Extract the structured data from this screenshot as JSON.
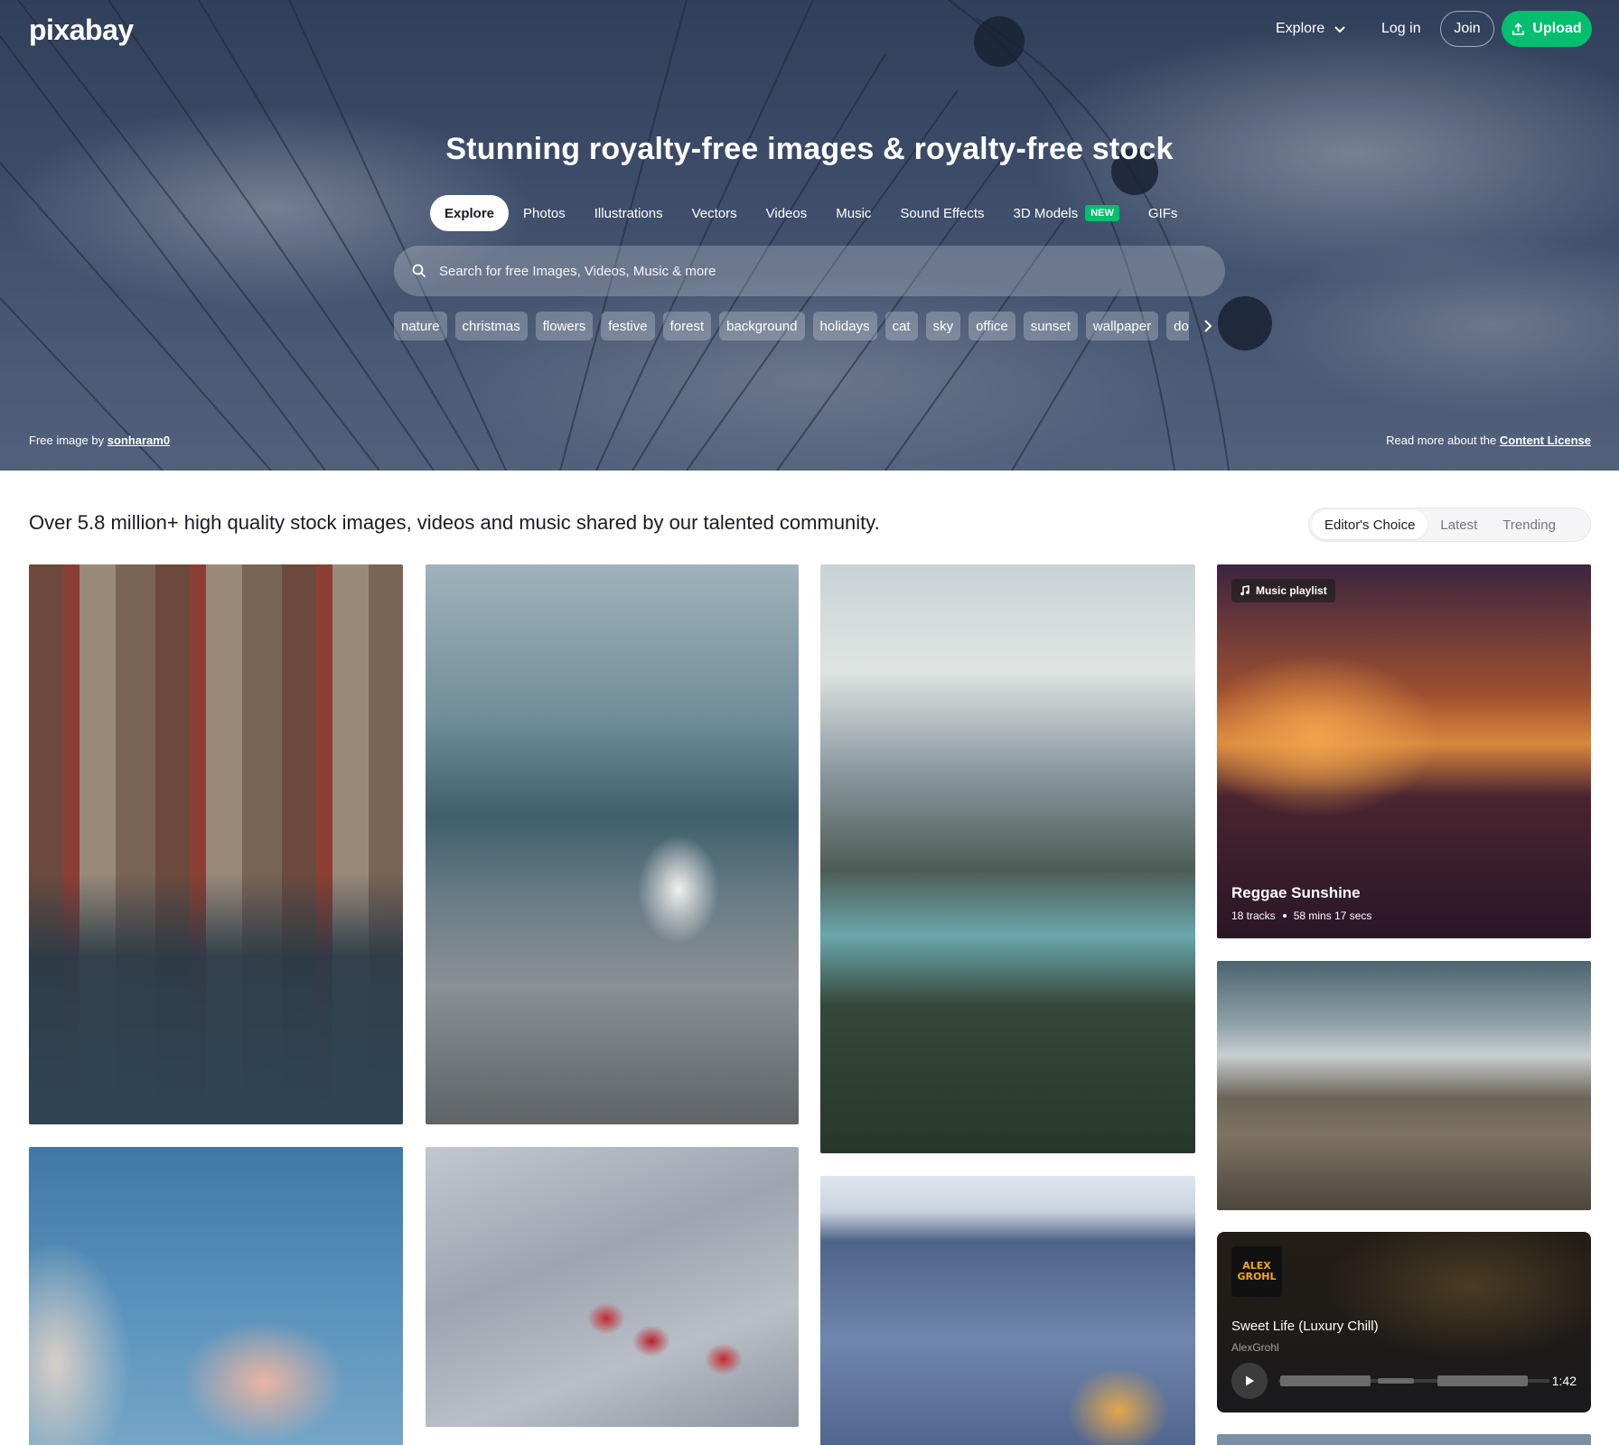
{
  "brand": {
    "logo_text": "pixabay"
  },
  "nav": {
    "explore_label": "Explore",
    "login_label": "Log in",
    "join_label": "Join",
    "upload_label": "Upload",
    "upload_color": "#02be6e"
  },
  "hero": {
    "title": "Stunning royalty-free images & royalty-free stock",
    "tabs": [
      {
        "label": "Explore",
        "active": true
      },
      {
        "label": "Photos"
      },
      {
        "label": "Illustrations"
      },
      {
        "label": "Vectors"
      },
      {
        "label": "Videos"
      },
      {
        "label": "Music"
      },
      {
        "label": "Sound Effects"
      },
      {
        "label": "3D Models",
        "badge": "NEW"
      },
      {
        "label": "GIFs"
      }
    ],
    "search": {
      "placeholder": "Search for free Images, Videos, Music & more",
      "value": ""
    },
    "chips": [
      "nature",
      "christmas",
      "flowers",
      "festive",
      "forest",
      "background",
      "holidays",
      "cat",
      "sky",
      "office",
      "sunset",
      "wallpaper",
      "dog"
    ],
    "credit_prefix": "Free image by",
    "credit_author": "sonharam0",
    "license_prefix": "Read more about the",
    "license_link": "Content License"
  },
  "main": {
    "intro": "Over 5.8 million+ high quality stock images, videos and music shared by our talented community.",
    "filters": [
      {
        "label": "Editor's Choice",
        "active": true
      },
      {
        "label": "Latest"
      },
      {
        "label": "Trending"
      }
    ],
    "playlist": {
      "badge": "Music playlist",
      "title": "Reggae Sunshine",
      "tracks": "18 tracks",
      "duration": "58 mins 17 secs"
    },
    "track": {
      "art_line1": "ALEX",
      "art_line2": "GROHL",
      "title": "Sweet Life (Luxury Chill)",
      "artist": "AlexGrohl",
      "duration": "1:42"
    }
  }
}
